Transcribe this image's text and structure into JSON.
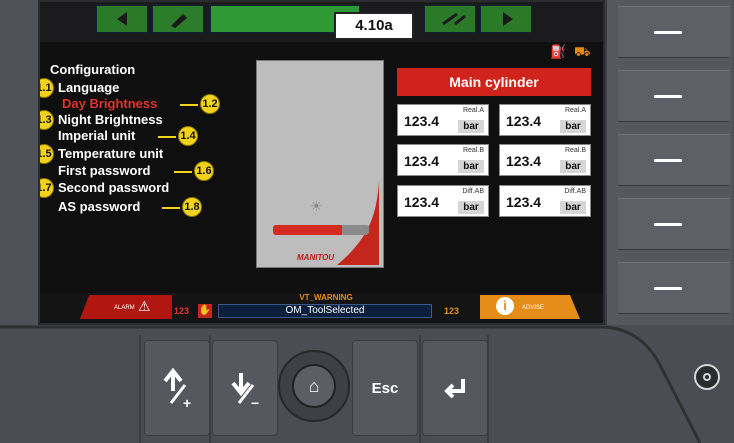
{
  "figure_label": "4.10a",
  "config": {
    "title": "Configuration",
    "items": [
      {
        "label": "Language",
        "badge": "1.1",
        "selected": false
      },
      {
        "label": "Day Brightness",
        "badge": "1.2",
        "selected": true
      },
      {
        "label": "Night Brightness",
        "badge": "1.3",
        "selected": false
      },
      {
        "label": "Imperial unit",
        "badge": "1.4",
        "selected": false
      },
      {
        "label": "Temperature unit",
        "badge": "1.5",
        "selected": false
      },
      {
        "label": "First password",
        "badge": "1.6",
        "selected": false
      },
      {
        "label": "Second password",
        "badge": "1.7",
        "selected": false
      },
      {
        "label": "AS password",
        "badge": "1.8",
        "selected": false
      }
    ]
  },
  "brightness": {
    "level_fraction": 0.72,
    "brand": "MANITOU",
    "icon": "sun-icon"
  },
  "main_cylinder": {
    "title": "Main cylinder",
    "cells": [
      {
        "value": "123.4",
        "label": "Real.A",
        "unit": "bar"
      },
      {
        "value": "123.4",
        "label": "Real.A",
        "unit": "bar"
      },
      {
        "value": "123.4",
        "label": "Real.B",
        "unit": "bar"
      },
      {
        "value": "123.4",
        "label": "Real.B",
        "unit": "bar"
      },
      {
        "value": "123.4",
        "label": "Diff.AB",
        "unit": "bar"
      },
      {
        "value": "123.4",
        "label": "Diff.AB",
        "unit": "bar"
      }
    ]
  },
  "status": {
    "alarm_label": "ALARM",
    "alarm_count": "123",
    "warning_title": "VT_WARNING",
    "warning_message": "OM_ToolSelected",
    "advise_count": "123",
    "advise_label": "ADVISE"
  },
  "keys": {
    "plus_label": "+",
    "minus_label": "−",
    "esc_label": "Esc"
  },
  "colors": {
    "accent_red": "#d0231b",
    "badge_yellow": "#f2d21b",
    "warning_orange": "#e58b12"
  }
}
